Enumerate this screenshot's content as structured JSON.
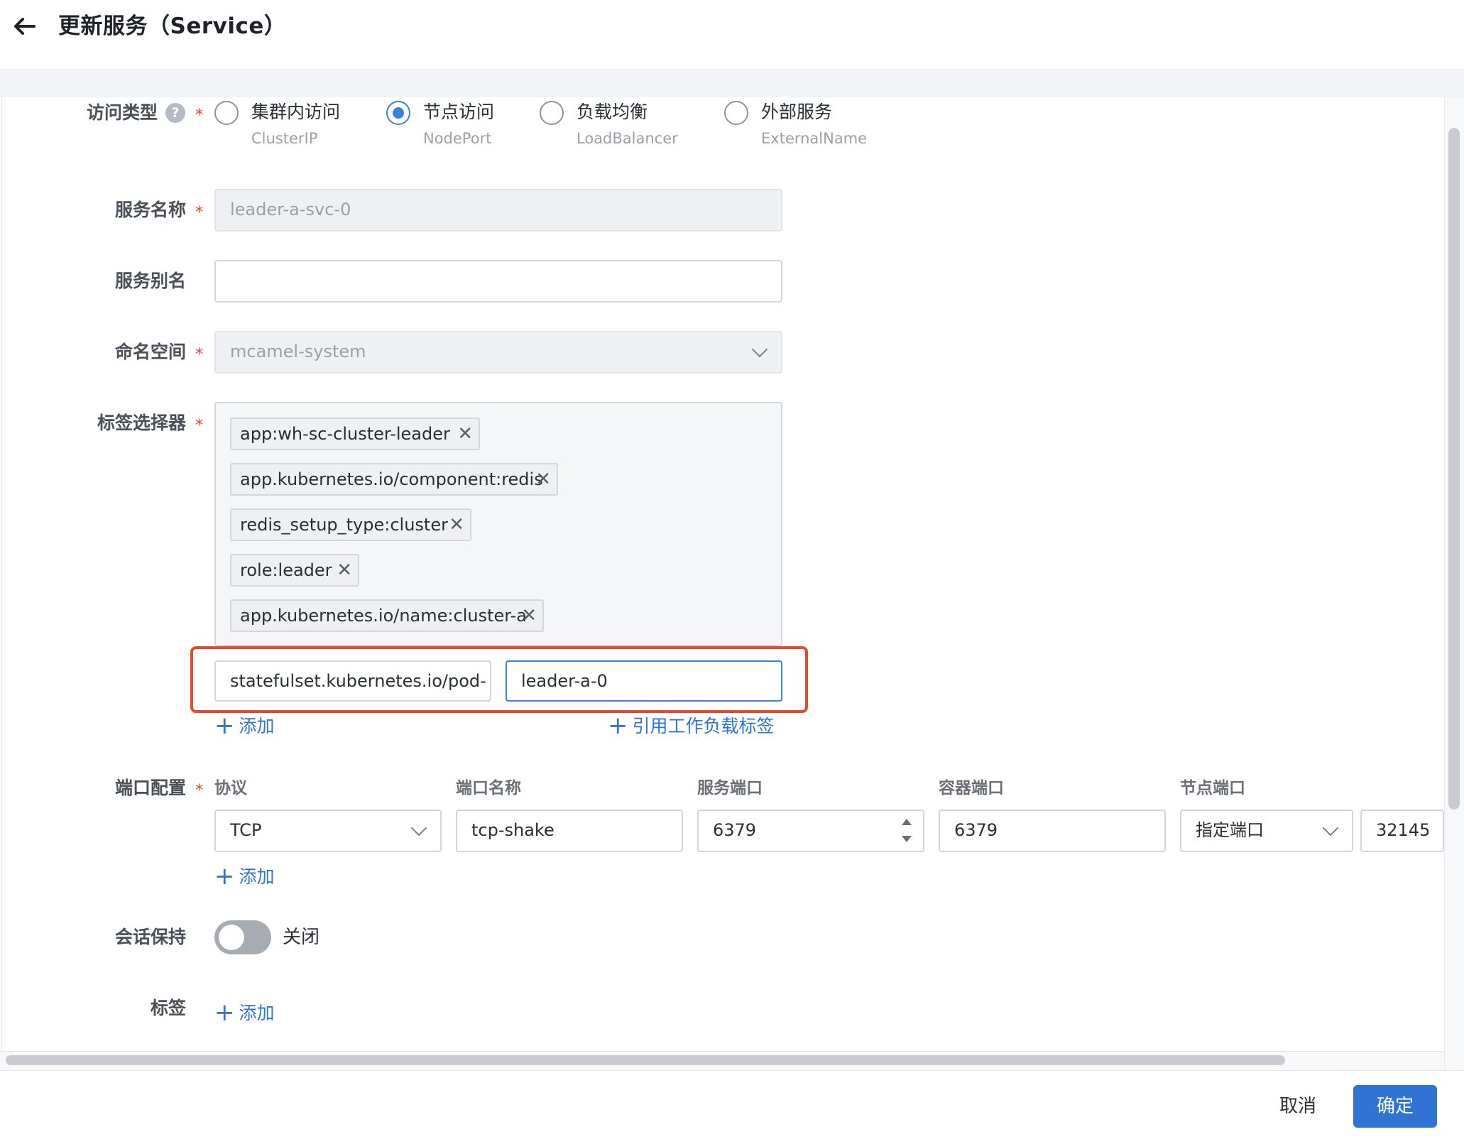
{
  "header": {
    "title": "更新服务（Service）"
  },
  "form": {
    "access_type": {
      "label": "访问类型",
      "help": "?",
      "options": [
        {
          "title": "集群内访问",
          "sub": "ClusterIP",
          "checked": false
        },
        {
          "title": "节点访问",
          "sub": "NodePort",
          "checked": true
        },
        {
          "title": "负载均衡",
          "sub": "LoadBalancer",
          "checked": false
        },
        {
          "title": "外部服务",
          "sub": "ExternalName",
          "checked": false
        }
      ]
    },
    "service_name": {
      "label": "服务名称",
      "value": "leader-a-svc-0"
    },
    "service_alias": {
      "label": "服务别名",
      "value": ""
    },
    "namespace": {
      "label": "命名空间",
      "value": "mcamel-system"
    },
    "label_selector": {
      "label": "标签选择器",
      "tags": [
        "app:wh-sc-cluster-leader",
        "app.kubernetes.io/component:redis",
        "redis_setup_type:cluster",
        "role:leader",
        "app.kubernetes.io/name:cluster-a"
      ],
      "key_value": "statefulset.kubernetes.io/pod-",
      "value_value": "leader-a-0",
      "add_label": "添加",
      "ref_workload_label": "引用工作负载标签"
    },
    "ports": {
      "label": "端口配置",
      "headers": [
        "协议",
        "端口名称",
        "服务端口",
        "容器端口",
        "节点端口"
      ],
      "row": {
        "protocol": "TCP",
        "name": "tcp-shake",
        "service_port": "6379",
        "container_port": "6379",
        "node_port_mode": "指定端口",
        "node_port": "32145"
      },
      "add_label": "添加"
    },
    "session": {
      "label": "会话保持",
      "state": "关闭"
    },
    "labels": {
      "label": "标签",
      "add_label": "添加"
    }
  },
  "footer": {
    "cancel": "取消",
    "confirm": "确定"
  },
  "required_mark": "*",
  "colors": {
    "accent": "#2f74d4",
    "highlight_box": "#e04b32",
    "required": "#e8453c"
  }
}
